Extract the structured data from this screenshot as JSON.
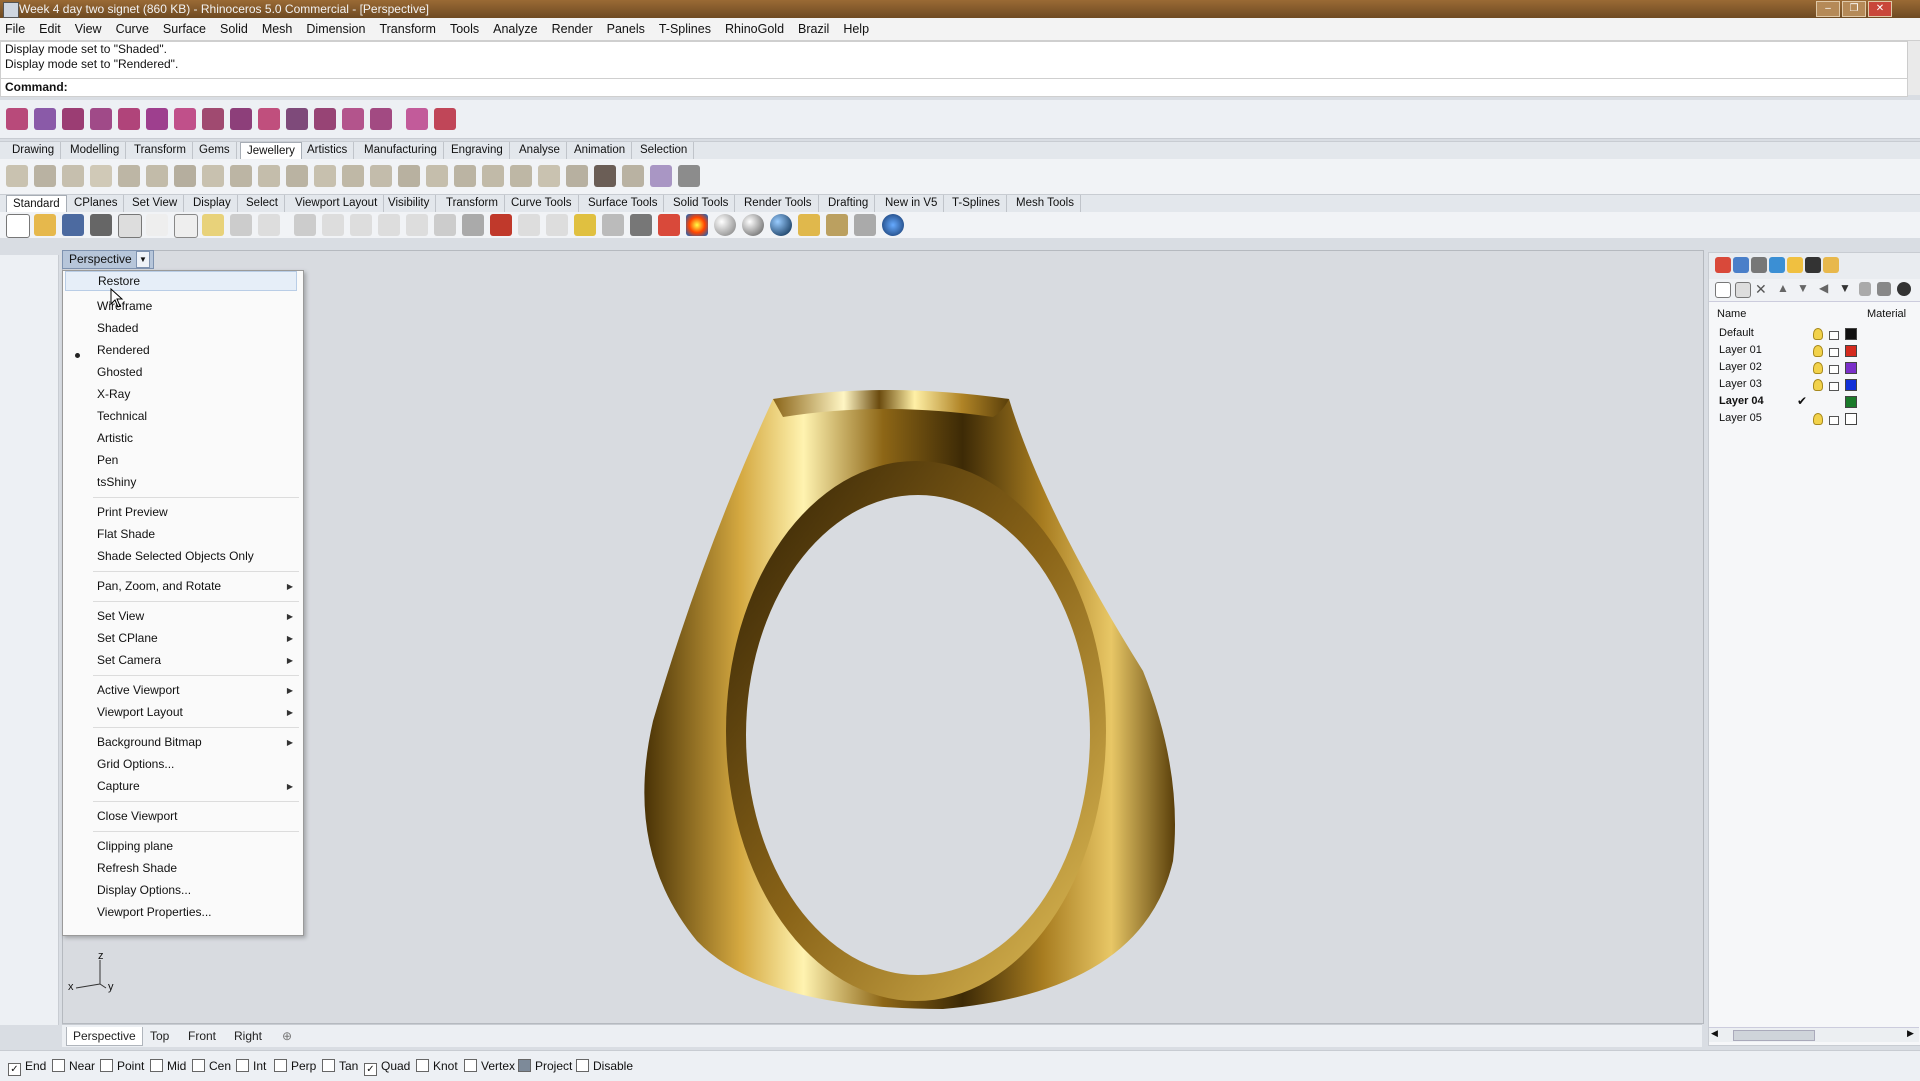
{
  "window": {
    "title": "Week 4 day two signet (860 KB) - Rhinoceros 5.0 Commercial - [Perspective]",
    "controls": [
      "–",
      "❐",
      "✕"
    ]
  },
  "menubar": [
    "File",
    "Edit",
    "View",
    "Curve",
    "Surface",
    "Solid",
    "Mesh",
    "Dimension",
    "Transform",
    "Tools",
    "Analyze",
    "Render",
    "Panels",
    "T-Splines",
    "RhinoGold",
    "Brazil",
    "Help"
  ],
  "command_history": [
    "Display mode set to \"Shaded\".",
    "Display mode set to \"Rendered\"."
  ],
  "command": {
    "label": "Command:",
    "value": ""
  },
  "toolbar_tabs_1": [
    "Drawing",
    "Modelling",
    "Transform",
    "Gems",
    "Jewellery",
    "Artistics",
    "Manufacturing",
    "Engraving",
    "Analyse",
    "Animation",
    "Selection"
  ],
  "toolbar_tabs_1_active": "Jewellery",
  "toolbar_tabs_2": [
    "Standard",
    "CPlanes",
    "Set View",
    "Display",
    "Select",
    "Viewport Layout",
    "Visibility",
    "Transform",
    "Curve Tools",
    "Surface Tools",
    "Solid Tools",
    "Render Tools",
    "Drafting",
    "New in V5",
    "T-Splines",
    "Mesh Tools"
  ],
  "toolbar_tabs_2_active": "Standard",
  "viewport": {
    "title": "Perspective"
  },
  "context_menu": {
    "items": [
      {
        "label": "Restore"
      },
      {
        "label": "Wireframe"
      },
      {
        "label": "Shaded"
      },
      {
        "label": "Rendered",
        "checked": true
      },
      {
        "label": "Ghosted"
      },
      {
        "label": "X-Ray"
      },
      {
        "label": "Technical"
      },
      {
        "label": "Artistic"
      },
      {
        "label": "Pen"
      },
      {
        "label": "tsShiny"
      },
      {
        "label": "Print Preview"
      },
      {
        "label": "Flat Shade"
      },
      {
        "label": "Shade Selected Objects Only"
      },
      {
        "label": "Pan, Zoom, and Rotate",
        "submenu": true
      },
      {
        "label": "Set View",
        "submenu": true
      },
      {
        "label": "Set CPlane",
        "submenu": true
      },
      {
        "label": "Set Camera",
        "submenu": true
      },
      {
        "label": "Active Viewport",
        "submenu": true
      },
      {
        "label": "Viewport Layout",
        "submenu": true
      },
      {
        "label": "Background Bitmap",
        "submenu": true
      },
      {
        "label": "Grid Options..."
      },
      {
        "label": "Capture",
        "submenu": true
      },
      {
        "label": "Close Viewport"
      },
      {
        "label": "Clipping plane"
      },
      {
        "label": "Refresh Shade"
      },
      {
        "label": "Display Options..."
      },
      {
        "label": "Viewport Properties..."
      }
    ]
  },
  "axes": {
    "z": "z",
    "x": "x",
    "y": "y"
  },
  "view_tabs": [
    "Perspective",
    "Top",
    "Front",
    "Right"
  ],
  "view_tabs_active": "Perspective",
  "layers_panel": {
    "columns": {
      "name": "Name",
      "material": "Material"
    },
    "layers": [
      {
        "name": "Default",
        "color": "#111111",
        "current": false
      },
      {
        "name": "Layer 01",
        "color": "#d42a1e",
        "current": false
      },
      {
        "name": "Layer 02",
        "color": "#7a2fc9",
        "current": false
      },
      {
        "name": "Layer 03",
        "color": "#1030d8",
        "current": false
      },
      {
        "name": "Layer 04",
        "color": "#1a7a2a",
        "current": true
      },
      {
        "name": "Layer 05",
        "color": "#ffffff",
        "current": false
      }
    ],
    "current_mark": "✔"
  },
  "osnaps": [
    {
      "label": "End",
      "checked": true
    },
    {
      "label": "Near",
      "checked": false
    },
    {
      "label": "Point",
      "checked": false
    },
    {
      "label": "Mid",
      "checked": false
    },
    {
      "label": "Cen",
      "checked": false
    },
    {
      "label": "Int",
      "checked": false
    },
    {
      "label": "Perp",
      "checked": false
    },
    {
      "label": "Tan",
      "checked": false
    },
    {
      "label": "Quad",
      "checked": true
    },
    {
      "label": "Knot",
      "checked": false
    },
    {
      "label": "Vertex",
      "checked": false
    },
    {
      "label": "Project",
      "checked": false,
      "filled": true
    },
    {
      "label": "Disable",
      "checked": false
    }
  ],
  "colors": {
    "gold_light": "#fff3b0",
    "gold_mid": "#b8892a",
    "gold_dark": "#3d2a06",
    "viewport_bg": "#d8dbe0"
  }
}
